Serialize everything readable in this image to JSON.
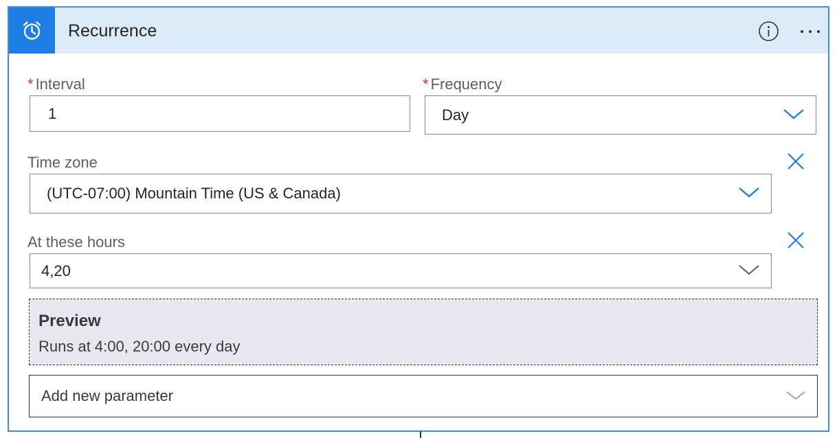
{
  "card": {
    "title": "Recurrence",
    "accent_color": "#1f7de6",
    "header_bg": "#ddeaf8",
    "icon": "alarm-clock-icon"
  },
  "interval": {
    "required_mark": "*",
    "label": "Interval",
    "value": "1"
  },
  "frequency": {
    "required_mark": "*",
    "label": "Frequency",
    "value": "Day"
  },
  "time_zone": {
    "label": "Time zone",
    "value": "(UTC-07:00) Mountain Time (US & Canada)"
  },
  "hours": {
    "label": "At these hours",
    "value": "4,20"
  },
  "preview": {
    "title": "Preview",
    "text": "Runs at 4:00, 20:00 every day"
  },
  "add_parameter": {
    "label": "Add new parameter"
  }
}
